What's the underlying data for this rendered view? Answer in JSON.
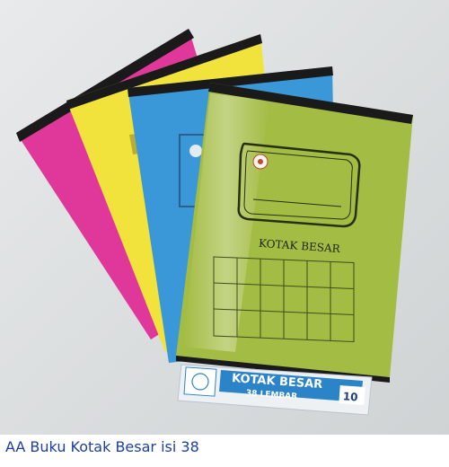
{
  "photo": {
    "front_book_title": "KOTAK BESAR",
    "label_title": "KOTAK BESAR",
    "label_subtitle": "38 LEMBAR",
    "label_count": "10",
    "colors": {
      "pink": "#e0389a",
      "yellow": "#f2e23c",
      "blue": "#3a97d8",
      "green": "#a3bc43",
      "spine": "#1a1a1a",
      "label_blue": "#2c84c8"
    }
  },
  "caption": "AA Buku Kotak Besar isi 38"
}
